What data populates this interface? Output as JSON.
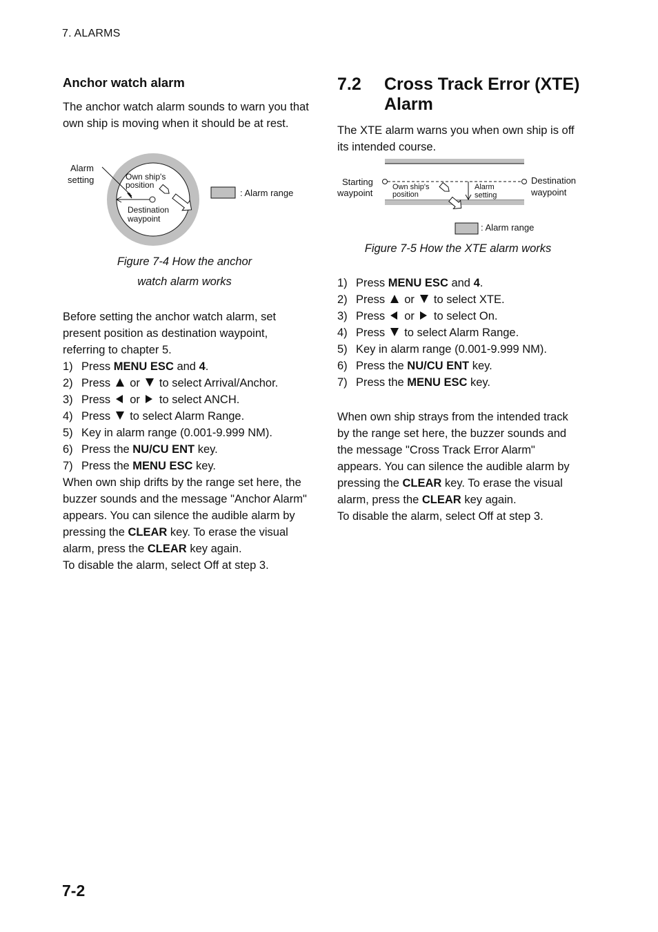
{
  "header": {
    "running_head": "7. ALARMS"
  },
  "anchor": {
    "heading": "Anchor watch alarm",
    "intro": "The anchor watch alarm sounds to warn you that own ship is moving when it should be at rest.",
    "figure": {
      "labels": {
        "alarm_setting_1": "Alarm",
        "alarm_setting_2": "setting",
        "own_ship_1": "Own ship's",
        "own_ship_2": "position",
        "destination_1": "Destination",
        "destination_2": "waypoint",
        "legend": ": Alarm range"
      },
      "caption_line1": "Figure 7-4 How the anchor",
      "caption_line2": "watch alarm works"
    },
    "preface": "Before setting the anchor watch alarm, set present position as destination waypoint, referring to chapter 5.",
    "steps": [
      {
        "n": "1)",
        "pre": "Press ",
        "key1": "MENU ESC",
        "mid": " and ",
        "key2": "4",
        "post": "."
      },
      {
        "n": "2)",
        "pre": "Press",
        "arrow1": "up-arrow",
        "or": "or",
        "arrow2": "down-arrow",
        "post": "to select Arrival/Anchor."
      },
      {
        "n": "3)",
        "pre": "Press",
        "arrow1": "left-arrow",
        "or": "or",
        "arrow2": "right-arrow",
        "post": "to select ANCH."
      },
      {
        "n": "4)",
        "pre": "Press",
        "arrow1": "down-arrow",
        "post": "to select Alarm Range."
      },
      {
        "n": "5)",
        "text": "Key in alarm range (0.001-9.999 NM)."
      },
      {
        "n": "6)",
        "pre": "Press the ",
        "key1": "NU/CU ENT",
        "post": " key."
      },
      {
        "n": "7)",
        "pre": "Press the ",
        "key1": "MENU ESC",
        "post": " key."
      }
    ],
    "after": {
      "p1": "When own ship drifts by the range set here, the buzzer sounds and the message \"Anchor Alarm\" appears. You can silence the audible alarm by pressing the ",
      "clear1": "CLEAR",
      "p2": " key. To erase the visual alarm, press the ",
      "clear2": "CLEAR",
      "p3": " key again.",
      "p4": "To disable the alarm, select Off at step 3."
    }
  },
  "xte": {
    "section_number": "7.2",
    "title": "Cross Track Error (XTE) Alarm",
    "intro": "The XTE alarm warns you when own ship is off its intended course.",
    "figure": {
      "labels": {
        "starting_1": "Starting",
        "starting_2": "waypoint",
        "own_ship_1": "Own ship's",
        "own_ship_2": "position",
        "alarm_1": "Alarm",
        "alarm_2": "setting",
        "destination_1": "Destination",
        "destination_2": "waypoint",
        "legend": ": Alarm range"
      },
      "caption": "Figure 7-5 How the XTE alarm works"
    },
    "steps": [
      {
        "n": "1)",
        "pre": "Press ",
        "key1": "MENU ESC",
        "mid": " and ",
        "key2": "4",
        "post": "."
      },
      {
        "n": "2)",
        "pre": "Press",
        "or": "or",
        "post": "to select XTE."
      },
      {
        "n": "3)",
        "pre": "Press",
        "or": "or",
        "post": "to select On."
      },
      {
        "n": "4)",
        "pre": "Press",
        "post": "to select Alarm Range."
      },
      {
        "n": "5)",
        "text": "Key in alarm range (0.001-9.999 NM)."
      },
      {
        "n": "6)",
        "pre": "Press the ",
        "key1": "NU/CU ENT",
        "post": " key."
      },
      {
        "n": "7)",
        "pre": "Press the ",
        "key1": "MENU ESC",
        "post": " key."
      }
    ],
    "after": {
      "p1": "When own ship strays from the intended track by the range set here, the buzzer sounds and the message \"Cross Track Error Alarm\" appears. You can silence the audible alarm by pressing the ",
      "clear1": "CLEAR",
      "p2": " key. To erase the visual alarm, press the ",
      "clear2": "CLEAR",
      "p3": " key again.",
      "p4": "To disable the alarm, select Off at step 3."
    }
  },
  "footer": {
    "page_number": "7-2"
  },
  "colors": {
    "alarm_range_fill": "#c0c0c0",
    "text": "#111111"
  }
}
